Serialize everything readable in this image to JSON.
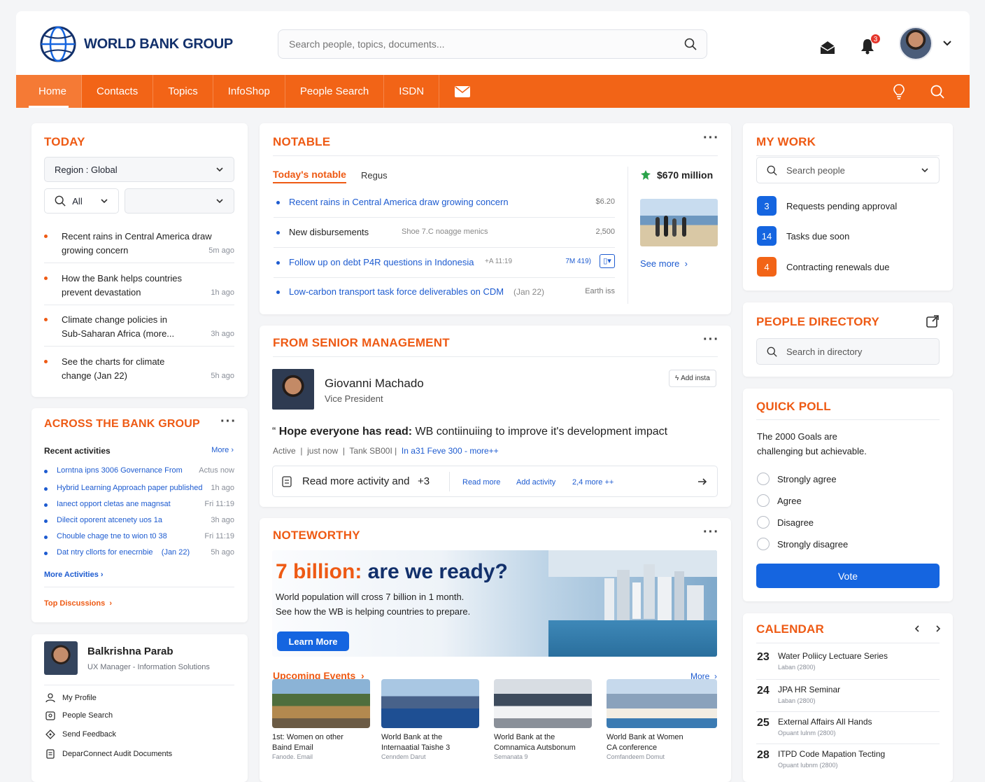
{
  "header": {
    "logo_text": "WORLD BANK GROUP",
    "search_placeholder": "Search people, topics, documents...",
    "notification_count": "3"
  },
  "nav": {
    "items": [
      "Home",
      "Contacts",
      "Topics",
      "InfoShop",
      "People Search",
      "ISDN"
    ]
  },
  "today": {
    "title": "TODAY",
    "region": "Region : Global",
    "filter_all": "All",
    "items": [
      {
        "text": "Recent rains in Central America draw growing concern",
        "ago": "5m ago"
      },
      {
        "text": "How the Bank helps countries prevent devastation",
        "ago": "1h ago"
      },
      {
        "text": "Climate change policies in Sub-Saharan Africa (more...",
        "ago": "3h ago"
      },
      {
        "text": "See the charts for climate change (Jan 22)",
        "ago": "5h ago"
      }
    ]
  },
  "across": {
    "title": "ACROSS THE BANK GROUP",
    "recent_label": "Recent activities",
    "more": "More",
    "activities": [
      {
        "text": "Lorntna ipns 3006 Governance From",
        "time": "Actus now"
      },
      {
        "text": "Hybrid Learning Approach paper published",
        "time": "1h ago"
      },
      {
        "text": "Ianect opport cletas ane magnsat",
        "time": "Fri 11:19"
      },
      {
        "text": "Dilecit oporent atcenety uos 1a",
        "time": "3h ago"
      },
      {
        "text": "Chouble chage tne to wion t0 38",
        "time": "Fri 11:19"
      },
      {
        "text": "Dat ntry cllorts for enecrnbie    (Jan 22)",
        "time": "5h ago"
      }
    ],
    "more_activities": "More Activities",
    "top_discussions": "Top Discussions"
  },
  "profile": {
    "name": "Balkrishna Parab",
    "role": "UX Manager - Information Solutions",
    "links": [
      "My Profile",
      "People Search",
      "Send Feedback",
      "DeparConnect Audit Documents"
    ]
  },
  "notable": {
    "title": "NOTABLE",
    "tab_active": "Today's notable",
    "tab_other": "Regus",
    "rows": [
      {
        "text": "Recent rains in Central America draw growing concern",
        "meta": "",
        "value": "$6.20"
      },
      {
        "text": "New disbursements",
        "meta": "Shoe 7.C noagge menics",
        "value": "2,500"
      },
      {
        "text": "Follow up on debt P4R questions in Indonesia",
        "meta": "+A 11:19",
        "value": "7M 419)"
      },
      {
        "text": "Low-carbon transport task force deliverables on CDM",
        "meta": "(Jan 22)",
        "value": "Earth iss"
      }
    ],
    "side_amount": "$670 million",
    "see_more": "See more"
  },
  "senior": {
    "title": "FROM SENIOR MANAGEMENT",
    "name": "Giovanni Machado",
    "role": "Vice President",
    "add_btn": "Add insta",
    "quote_bold": "Hope everyone has read:",
    "quote_rest": "WB contiinuiing to improve it's development impact",
    "meta_active": "Active",
    "meta_time": "just now",
    "meta_tank": "Tank SB00I",
    "meta_link": "In a31 Feve 300 - more++",
    "read_more_activity": "Read more activity and",
    "plus": "+3",
    "read_more": "Read more",
    "add_activity": "Add activity",
    "more_count": "2,4 more ++"
  },
  "noteworthy": {
    "title": "NOTEWORTHY",
    "headline_accent": "7 billion:",
    "headline_rest": "are we ready?",
    "line1": "World population will cross 7 billion in 1 month.",
    "line2": "See how the WB is helping countries to prepare.",
    "cta": "Learn More",
    "upcoming": "Upcoming Events",
    "more": "More",
    "events": [
      {
        "t1": "1st: Women on other",
        "t2": "Baind Email",
        "s": "Fanode. Email"
      },
      {
        "t1": "World Bank at the",
        "t2": "Internaatial Taishe 3",
        "s": "Cenndem Darut"
      },
      {
        "t1": "World Bank at the",
        "t2": "Comnamica Autsbonum",
        "s": "Semanata 9"
      },
      {
        "t1": "World Bank at Women",
        "t2": "CA conference",
        "s": "Comfandeem Domut"
      }
    ]
  },
  "mywork": {
    "title": "MY WORK",
    "search_placeholder": "Search people",
    "items": [
      {
        "count": "3",
        "label": "Requests pending approval",
        "color": "#1565e0"
      },
      {
        "count": "14",
        "label": "Tasks due soon",
        "color": "#1565e0"
      },
      {
        "count": "4",
        "label": "Contracting renewals due",
        "color": "#f26417"
      }
    ]
  },
  "directory": {
    "title": "PEOPLE DIRECTORY",
    "search_placeholder": "Search in directory"
  },
  "poll": {
    "title": "QUICK POLL",
    "question": "The 2000 Goals are challenging but achievable.",
    "options": [
      "Strongly agree",
      "Agree",
      "Disagree",
      "Strongly disagree"
    ],
    "vote": "Vote"
  },
  "calendar": {
    "title": "CALENDAR",
    "events": [
      {
        "day": "23",
        "title": "Water Poliicy Lectuare Series",
        "sub": "Laban (2800)"
      },
      {
        "day": "24",
        "title": "JPA HR Seminar",
        "sub": "Laban (2800)"
      },
      {
        "day": "25",
        "title": "External Affairs All Hands",
        "sub": "Opuant Iulnm (2800)"
      },
      {
        "day": "28",
        "title": "ITPD Code Mapation Tecting",
        "sub": "Opuant Iubnm (2800)"
      }
    ]
  },
  "colors": {
    "brand_orange": "#f26417",
    "accent_blue": "#1565e0",
    "title_orange": "#ee5a14",
    "navy": "#12306b"
  }
}
